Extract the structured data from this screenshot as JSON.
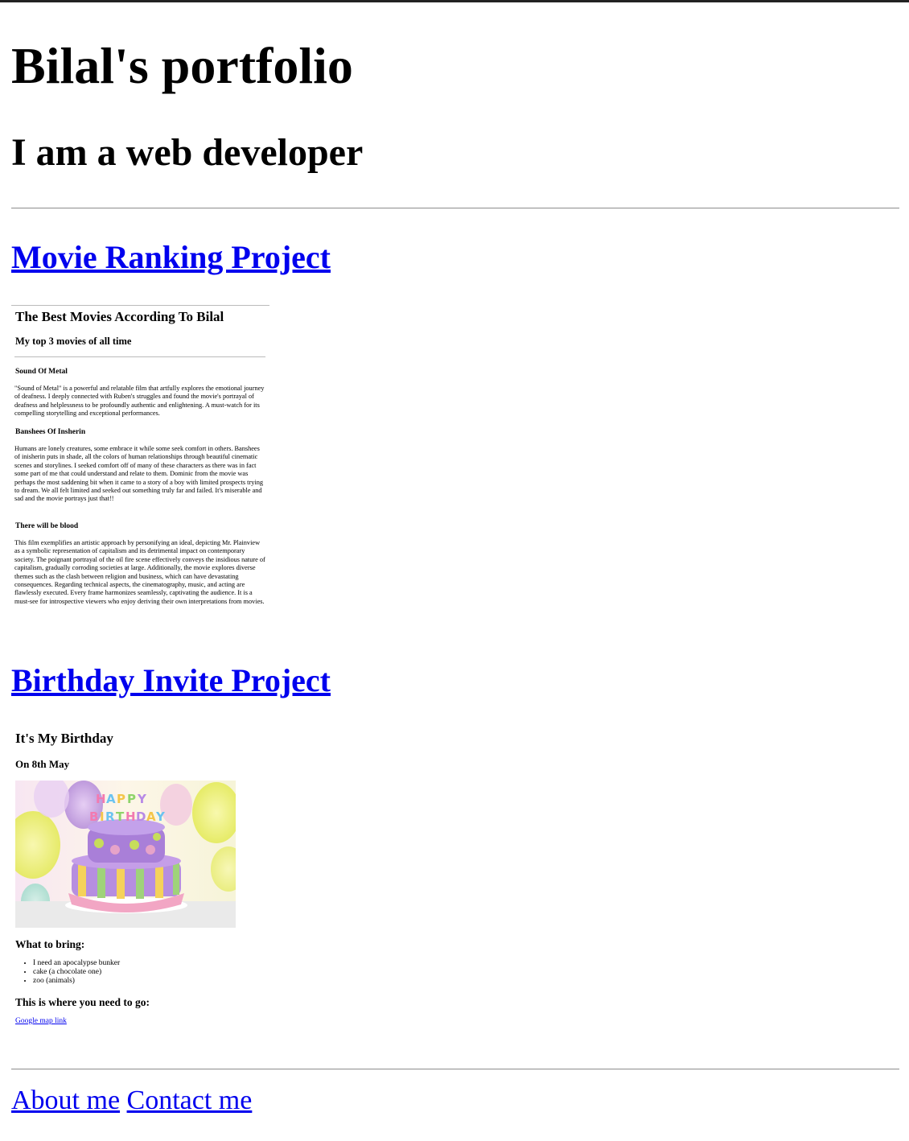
{
  "header": {
    "title": "Bilal's portfolio",
    "subtitle": "I am a web developer"
  },
  "projects": [
    {
      "link_label": "Movie Ranking Project",
      "preview": {
        "heading": "The Best Movies According To Bilal",
        "subheading": "My top 3 movies of all time",
        "movies": [
          {
            "title": "Sound Of Metal",
            "review": "\"Sound of Metal\" is a powerful and relatable film that artfully explores the emotional journey of deafness. I deeply connected with Ruben's struggles and found the movie's portrayal of deafness and helplessness to be profoundly authentic and enlightening. A must-watch for its compelling storytelling and exceptional performances."
          },
          {
            "title": "Banshees Of Insherin",
            "review": "Humans are lonely creatures, some embrace it while some seek comfort in others. Banshees of inisherin puts in shade, all the colors of human relationships through beautiful cinematic scenes and storylines. I seeked comfort off of many of these characters as there was in fact some part of me that could understand and relate to them. Dominic from the movie was perhaps the most saddening bit when it came to a story of a boy with limited prospects trying to dream. We all felt limited and seeked out something truly far and failed. It's miserable and sad and the movie portrays just that!!"
          },
          {
            "title": "There will be blood",
            "review": "This film exemplifies an artistic approach by personifying an ideal, depicting Mr. Plainview as a symbolic representation of capitalism and its detrimental impact on contemporary society. The poignant portrayal of the oil fire scene effectively conveys the insidious nature of capitalism, gradually corroding societies at large. Additionally, the movie explores diverse themes such as the clash between religion and business, which can have devastating consequences. Regarding technical aspects, the cinematography, music, and acting are flawlessly executed. Every frame harmonizes seamlessly, captivating the audience. It is a must-see for introspective viewers who enjoy deriving their own interpretations from movies."
          }
        ]
      }
    },
    {
      "link_label": "Birthday Invite Project",
      "preview": {
        "heading": "It's My Birthday",
        "date": "On 8th May",
        "cake_text": "HAPPY BIRTHDAY",
        "bring_heading": "What to bring:",
        "bring_items": [
          "I need an apocalypse bunker",
          "cake (a chocolate one)",
          "zoo (animals)"
        ],
        "where_heading": "This is where you need to go:",
        "map_link": "Google map link"
      }
    }
  ],
  "footer": {
    "about": "About me",
    "contact": "Contact me"
  },
  "colors": {
    "link": "#0000ee",
    "text": "#000000",
    "background": "#ffffff"
  }
}
